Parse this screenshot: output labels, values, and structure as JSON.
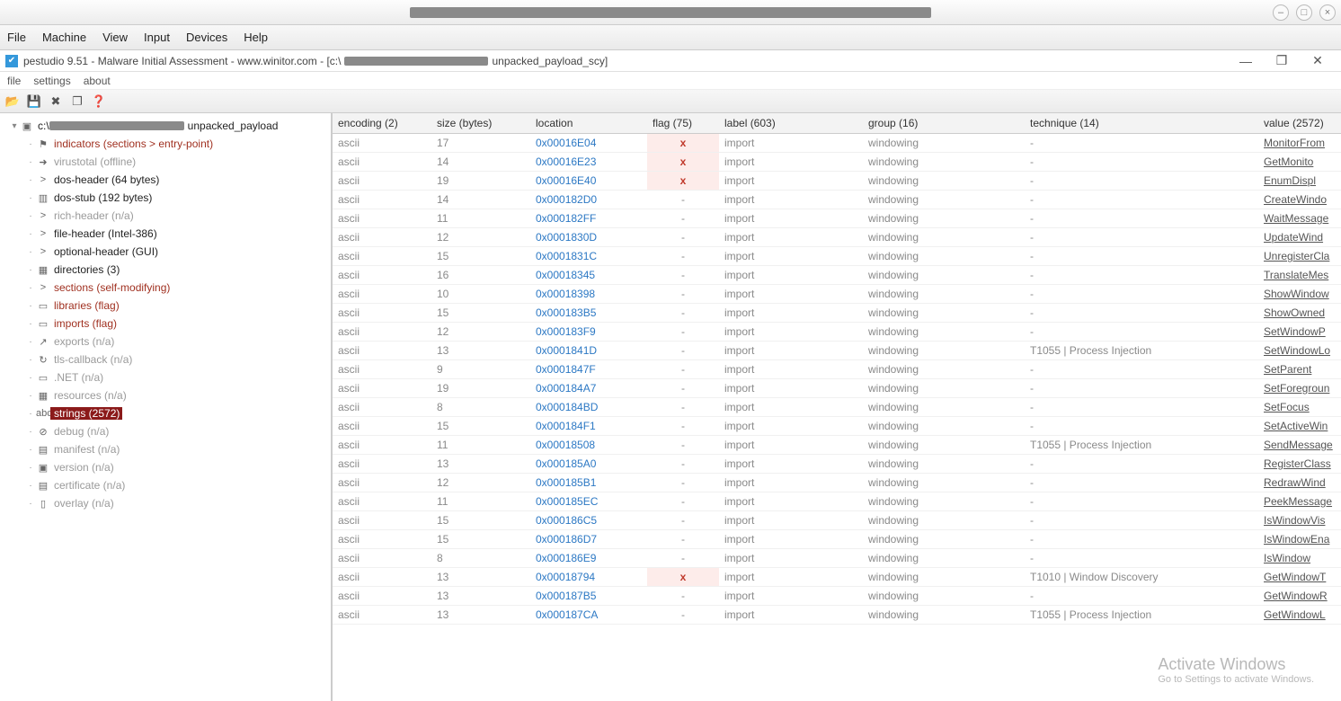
{
  "vm_menu": [
    "File",
    "Machine",
    "View",
    "Input",
    "Devices",
    "Help"
  ],
  "app_title_prefix": "pestudio 9.51 - Malware Initial Assessment - www.winitor.com - [c:\\",
  "app_title_suffix": "unpacked_payload_scy]",
  "app_menu": [
    "file",
    "settings",
    "about"
  ],
  "tree": {
    "root_prefix": "c:\\",
    "root_suffix": "unpacked_payload",
    "items": [
      {
        "label": "indicators (sections > entry-point)",
        "cls": "red",
        "icon": "⚑"
      },
      {
        "label": "virustotal (offline)",
        "cls": "gray",
        "icon": "➜"
      },
      {
        "label": "dos-header (64 bytes)",
        "cls": "black",
        "icon": ">"
      },
      {
        "label": "dos-stub (192 bytes)",
        "cls": "black",
        "icon": "▥"
      },
      {
        "label": "rich-header (n/a)",
        "cls": "gray",
        "icon": ">"
      },
      {
        "label": "file-header (Intel-386)",
        "cls": "black",
        "icon": ">"
      },
      {
        "label": "optional-header (GUI)",
        "cls": "black",
        "icon": ">"
      },
      {
        "label": "directories (3)",
        "cls": "black",
        "icon": "▦"
      },
      {
        "label": "sections (self-modifying)",
        "cls": "red",
        "icon": ">"
      },
      {
        "label": "libraries (flag)",
        "cls": "red",
        "icon": "▭"
      },
      {
        "label": "imports (flag)",
        "cls": "red",
        "icon": "▭"
      },
      {
        "label": "exports (n/a)",
        "cls": "gray",
        "icon": "↗"
      },
      {
        "label": "tls-callback (n/a)",
        "cls": "gray",
        "icon": "↻"
      },
      {
        "label": ".NET (n/a)",
        "cls": "gray",
        "icon": "▭"
      },
      {
        "label": "resources (n/a)",
        "cls": "gray",
        "icon": "▦"
      },
      {
        "label": "strings (2572)",
        "cls": "selected",
        "icon": "abc"
      },
      {
        "label": "debug (n/a)",
        "cls": "gray",
        "icon": "⊘"
      },
      {
        "label": "manifest (n/a)",
        "cls": "gray",
        "icon": "▤"
      },
      {
        "label": "version (n/a)",
        "cls": "gray",
        "icon": "▣"
      },
      {
        "label": "certificate (n/a)",
        "cls": "gray",
        "icon": "▤"
      },
      {
        "label": "overlay (n/a)",
        "cls": "gray",
        "icon": "▯"
      }
    ]
  },
  "columns": {
    "encoding": "encoding (2)",
    "size": "size (bytes)",
    "location": "location",
    "flag": "flag (75)",
    "label": "label (603)",
    "group": "group (16)",
    "technique": "technique (14)",
    "value": "value (2572)"
  },
  "rows": [
    {
      "enc": "ascii",
      "size": "17",
      "loc": "0x00016E04",
      "flag": "x",
      "label": "import",
      "group": "windowing",
      "tech": "-",
      "val": "MonitorFrom"
    },
    {
      "enc": "ascii",
      "size": "14",
      "loc": "0x00016E23",
      "flag": "x",
      "label": "import",
      "group": "windowing",
      "tech": "-",
      "val": "GetMonito"
    },
    {
      "enc": "ascii",
      "size": "19",
      "loc": "0x00016E40",
      "flag": "x",
      "label": "import",
      "group": "windowing",
      "tech": "-",
      "val": "EnumDispl"
    },
    {
      "enc": "ascii",
      "size": "14",
      "loc": "0x000182D0",
      "flag": "-",
      "label": "import",
      "group": "windowing",
      "tech": "-",
      "val": "CreateWindo"
    },
    {
      "enc": "ascii",
      "size": "11",
      "loc": "0x000182FF",
      "flag": "-",
      "label": "import",
      "group": "windowing",
      "tech": "-",
      "val": "WaitMessage"
    },
    {
      "enc": "ascii",
      "size": "12",
      "loc": "0x0001830D",
      "flag": "-",
      "label": "import",
      "group": "windowing",
      "tech": "-",
      "val": "UpdateWind"
    },
    {
      "enc": "ascii",
      "size": "15",
      "loc": "0x0001831C",
      "flag": "-",
      "label": "import",
      "group": "windowing",
      "tech": "-",
      "val": "UnregisterCla"
    },
    {
      "enc": "ascii",
      "size": "16",
      "loc": "0x00018345",
      "flag": "-",
      "label": "import",
      "group": "windowing",
      "tech": "-",
      "val": "TranslateMes"
    },
    {
      "enc": "ascii",
      "size": "10",
      "loc": "0x00018398",
      "flag": "-",
      "label": "import",
      "group": "windowing",
      "tech": "-",
      "val": "ShowWindow"
    },
    {
      "enc": "ascii",
      "size": "15",
      "loc": "0x000183B5",
      "flag": "-",
      "label": "import",
      "group": "windowing",
      "tech": "-",
      "val": "ShowOwned"
    },
    {
      "enc": "ascii",
      "size": "12",
      "loc": "0x000183F9",
      "flag": "-",
      "label": "import",
      "group": "windowing",
      "tech": "-",
      "val": "SetWindowP"
    },
    {
      "enc": "ascii",
      "size": "13",
      "loc": "0x0001841D",
      "flag": "-",
      "label": "import",
      "group": "windowing",
      "tech": "T1055 | Process Injection",
      "val": "SetWindowLo"
    },
    {
      "enc": "ascii",
      "size": "9",
      "loc": "0x0001847F",
      "flag": "-",
      "label": "import",
      "group": "windowing",
      "tech": "-",
      "val": "SetParent"
    },
    {
      "enc": "ascii",
      "size": "19",
      "loc": "0x000184A7",
      "flag": "-",
      "label": "import",
      "group": "windowing",
      "tech": "-",
      "val": "SetForegroun"
    },
    {
      "enc": "ascii",
      "size": "8",
      "loc": "0x000184BD",
      "flag": "-",
      "label": "import",
      "group": "windowing",
      "tech": "-",
      "val": "SetFocus"
    },
    {
      "enc": "ascii",
      "size": "15",
      "loc": "0x000184F1",
      "flag": "-",
      "label": "import",
      "group": "windowing",
      "tech": "-",
      "val": "SetActiveWin"
    },
    {
      "enc": "ascii",
      "size": "11",
      "loc": "0x00018508",
      "flag": "-",
      "label": "import",
      "group": "windowing",
      "tech": "T1055 | Process Injection",
      "val": "SendMessage"
    },
    {
      "enc": "ascii",
      "size": "13",
      "loc": "0x000185A0",
      "flag": "-",
      "label": "import",
      "group": "windowing",
      "tech": "-",
      "val": "RegisterClass"
    },
    {
      "enc": "ascii",
      "size": "12",
      "loc": "0x000185B1",
      "flag": "-",
      "label": "import",
      "group": "windowing",
      "tech": "-",
      "val": "RedrawWind"
    },
    {
      "enc": "ascii",
      "size": "11",
      "loc": "0x000185EC",
      "flag": "-",
      "label": "import",
      "group": "windowing",
      "tech": "-",
      "val": "PeekMessage"
    },
    {
      "enc": "ascii",
      "size": "15",
      "loc": "0x000186C5",
      "flag": "-",
      "label": "import",
      "group": "windowing",
      "tech": "-",
      "val": "IsWindowVis"
    },
    {
      "enc": "ascii",
      "size": "15",
      "loc": "0x000186D7",
      "flag": "-",
      "label": "import",
      "group": "windowing",
      "tech": "-",
      "val": "IsWindowEna"
    },
    {
      "enc": "ascii",
      "size": "8",
      "loc": "0x000186E9",
      "flag": "-",
      "label": "import",
      "group": "windowing",
      "tech": "-",
      "val": "IsWindow"
    },
    {
      "enc": "ascii",
      "size": "13",
      "loc": "0x00018794",
      "flag": "x",
      "label": "import",
      "group": "windowing",
      "tech": "T1010 | Window Discovery",
      "val": "GetWindowT"
    },
    {
      "enc": "ascii",
      "size": "13",
      "loc": "0x000187B5",
      "flag": "-",
      "label": "import",
      "group": "windowing",
      "tech": "-",
      "val": "GetWindowR"
    },
    {
      "enc": "ascii",
      "size": "13",
      "loc": "0x000187CA",
      "flag": "-",
      "label": "import",
      "group": "windowing",
      "tech": "T1055 | Process Injection",
      "val": "GetWindowL"
    }
  ],
  "watermark": {
    "line1": "Activate Windows",
    "line2": "Go to Settings to activate Windows."
  }
}
